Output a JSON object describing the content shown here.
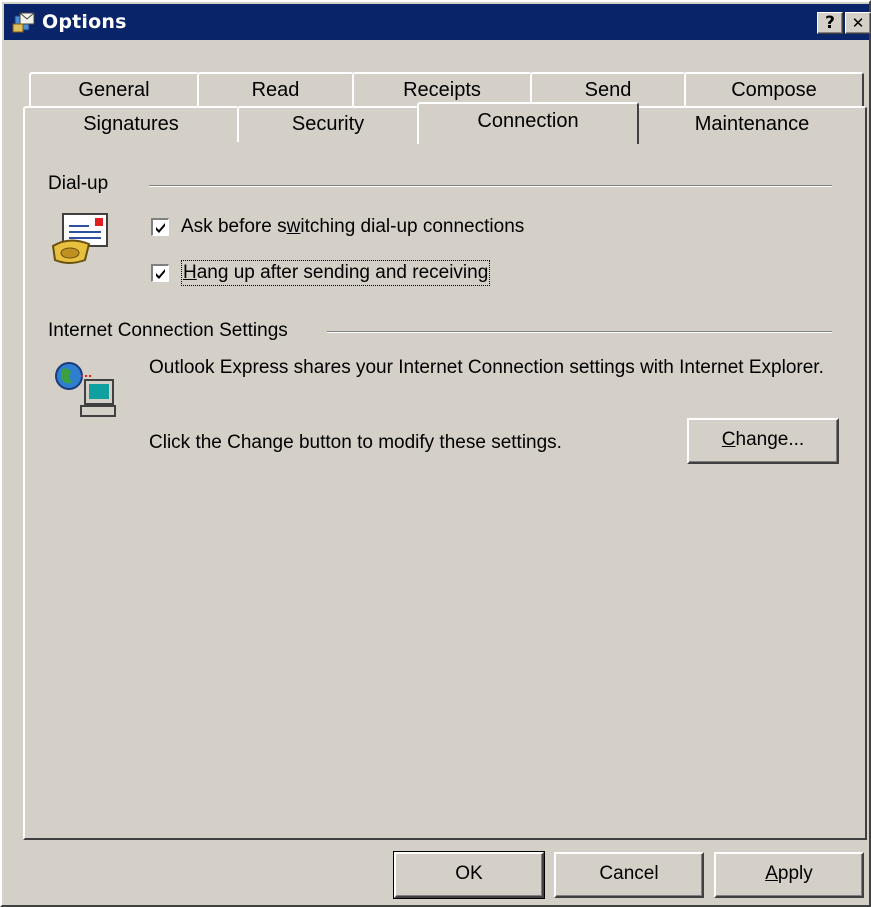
{
  "window": {
    "title": "Options",
    "help_label": "?",
    "close_label": "✕"
  },
  "tabs": {
    "row_back": [
      {
        "label": "General"
      },
      {
        "label": "Read"
      },
      {
        "label": "Receipts"
      },
      {
        "label": "Send"
      },
      {
        "label": "Compose"
      }
    ],
    "row_front": [
      {
        "label": "Signatures"
      },
      {
        "label": "Security"
      },
      {
        "label": "Connection",
        "selected": true
      },
      {
        "label": "Maintenance"
      }
    ]
  },
  "dialup": {
    "group_label": "Dial-up",
    "ask_before_switching": {
      "label_pre": "Ask before s",
      "label_key": "w",
      "label_post": "itching dial-up connections",
      "checked": true
    },
    "hang_up": {
      "label_key": "H",
      "label_post": "ang up after sending and receiving",
      "checked": true
    }
  },
  "internet": {
    "group_label": "Internet Connection Settings",
    "description": "Outlook Express shares your Internet Connection settings with Internet Explorer.",
    "change_hint": "Click the Change button to modify these settings.",
    "change_button": {
      "key": "C",
      "rest": "hange..."
    }
  },
  "footer": {
    "ok_label": "OK",
    "cancel_label": "Cancel",
    "apply_key": "A",
    "apply_rest": "pply"
  },
  "colors": {
    "titlebar": "#0a246a",
    "face": "#d4d0c8"
  }
}
